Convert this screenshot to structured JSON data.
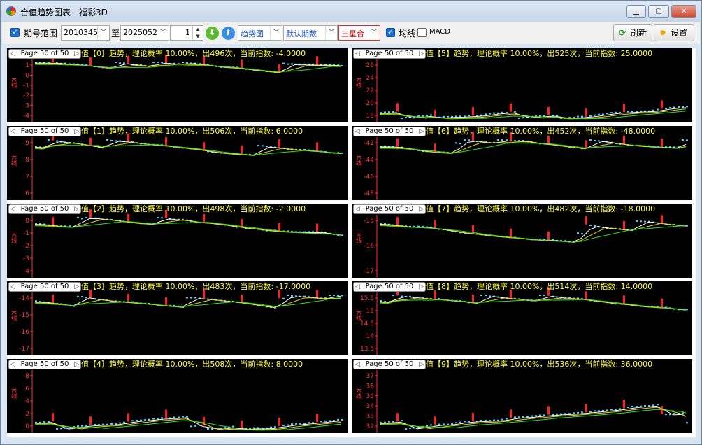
{
  "window": {
    "title": "合值趋势图表 - 福彩3D"
  },
  "toolbar": {
    "period_range_label": "期号范围",
    "from_period": "2010345",
    "to_label": "至",
    "to_period": "2025052",
    "step_value": "1",
    "view_mode": "趋势图",
    "period_mode": "默认期数",
    "combo_type": "三星合",
    "ma_label": "均线",
    "macd_label": "MACD",
    "refresh_label": "刷新",
    "settings_label": "设置"
  },
  "colors": {
    "kline_up": "#ff2020",
    "trend": "#4fd0ff",
    "ma_white": "#ffffff",
    "ma_yellow": "#e6d400",
    "ma_green": "#31e031"
  },
  "panels": [
    {
      "pager": "Page 50 of 50",
      "ylabel": "K线",
      "title": "值【0】趋势，理论概率 10.00%，出496次，当前指数: -4.0000",
      "ticks": [
        "1",
        "0",
        "-1",
        "-2",
        "-3",
        "-4"
      ]
    },
    {
      "pager": "Page 50 of 50",
      "ylabel": "K线",
      "title": "值【5】趋势，理论概率 10.00%，出525次，当前指数: 25.0000",
      "ticks": [
        "26",
        "24",
        "22",
        "20",
        "18"
      ]
    },
    {
      "pager": "Page 50 of 50",
      "ylabel": "K线",
      "title": "值【1】趋势，理论概率 10.00%，出506次，当前指数: 6.0000",
      "ticks": [
        "9",
        "8",
        "7",
        "6"
      ]
    },
    {
      "pager": "Page 50 of 50",
      "ylabel": "K线",
      "title": "值【6】趋势，理论概率 10.00%，出452次，当前指数: -48.0000",
      "ticks": [
        "-42",
        "-44",
        "-46",
        "-48"
      ]
    },
    {
      "pager": "Page 50 of 50",
      "ylabel": "K线",
      "title": "值【2】趋势，理论概率 10.00%，出498次，当前指数: -2.0000",
      "ticks": [
        "0",
        "-1",
        "-2",
        "-3",
        "-4"
      ]
    },
    {
      "pager": "Page 50 of 50",
      "ylabel": "K线",
      "title": "值【7】趋势，理论概率 10.00%，出482次，当前指数: -18.0000",
      "ticks": [
        "-15",
        "-16",
        "-17"
      ]
    },
    {
      "pager": "Page 50 of 50",
      "ylabel": "K线",
      "title": "值【3】趋势，理论概率 10.00%，出483次，当前指数: -17.0000",
      "ticks": [
        "-14",
        "-15",
        "-16",
        "-17"
      ]
    },
    {
      "pager": "Page 50 of 50",
      "ylabel": "K线",
      "title": "值【8】趋势，理论概率 10.00%，出514次，当前指数: 14.0000",
      "ticks": [
        "15.5",
        "15",
        "14.5",
        "14",
        "13.5"
      ]
    },
    {
      "pager": "Page 50 of 50",
      "ylabel": "K线",
      "title": "值【4】趋势，理论概率 10.00%，出508次，当前指数: 8.0000",
      "ticks": [
        "8",
        "6",
        "4",
        "2",
        "0"
      ]
    },
    {
      "pager": "Page 50 of 50",
      "ylabel": "K线",
      "title": "值【9】趋势，理论概率 10.00%，出536次，当前指数: 36.0000",
      "ticks": [
        "37",
        "36",
        "35",
        "34",
        "33",
        "32"
      ]
    }
  ]
}
